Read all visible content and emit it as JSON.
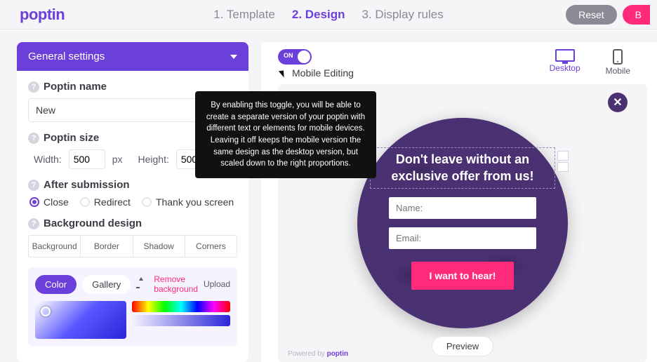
{
  "header": {
    "brand": "poptin",
    "steps": [
      "1. Template",
      "2. Design",
      "3. Display rules"
    ],
    "activeStep": 1,
    "reset_label": "Reset",
    "back_label": "B"
  },
  "sidebar": {
    "panel_title": "General settings",
    "name_label": "Poptin name",
    "name_value": "New",
    "size_label": "Poptin size",
    "width_label": "Width:",
    "width_value": "500",
    "height_label": "Height:",
    "height_value": "500",
    "unit": "px",
    "after_label": "After submission",
    "after_options": [
      "Close",
      "Redirect",
      "Thank you screen"
    ],
    "after_selected": 0,
    "bgdesign_label": "Background design",
    "bg_tabs": [
      "Background",
      "Border",
      "Shadow",
      "Corners"
    ],
    "color_chip": "Color",
    "gallery_chip": "Gallery",
    "remove_bg": "Remove background",
    "upload_label": "Upload"
  },
  "canvas": {
    "toggle_on": "ON",
    "mobile_editing_label": "Mobile Editing",
    "device_tabs": {
      "desktop": "Desktop",
      "mobile": "Mobile"
    },
    "preview_label": "Preview",
    "powered_prefix": "Powered by ",
    "powered_brand": "poptin"
  },
  "popup": {
    "headline": "Don't leave without an exclusive offer from us!",
    "name_placeholder": "Name:",
    "email_placeholder": "Email:",
    "cta_label": "I want to hear!"
  },
  "tooltip": {
    "text": "By enabling this toggle, you will be able to create a separate version of your poptin with different text or elements for mobile devices. Leaving it off keeps the mobile version the same design as the desktop version, but scaled down to the right proportions."
  }
}
